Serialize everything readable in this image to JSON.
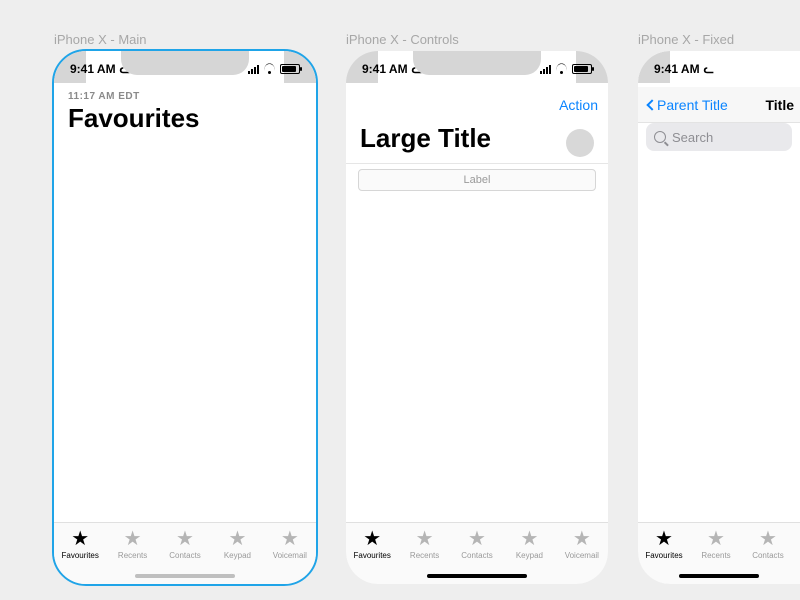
{
  "frames": {
    "main": {
      "label": "iPhone X - Main"
    },
    "controls": {
      "label": "iPhone X - Controls"
    },
    "fixed": {
      "label": "iPhone X - Fixed"
    }
  },
  "status": {
    "time": "9:41 AM"
  },
  "main": {
    "subtime": "11:17 AM EDT",
    "title": "Favourites"
  },
  "controls": {
    "action": "Action",
    "title": "Large Title",
    "segmented_label": "Label"
  },
  "fixed": {
    "back_label": "Parent Title",
    "title": "Title",
    "search_placeholder": "Search"
  },
  "tabs": [
    {
      "label": "Favourites",
      "active": true
    },
    {
      "label": "Recents",
      "active": false
    },
    {
      "label": "Contacts",
      "active": false
    },
    {
      "label": "Keypad",
      "active": false
    },
    {
      "label": "Voicemail",
      "active": false
    }
  ]
}
